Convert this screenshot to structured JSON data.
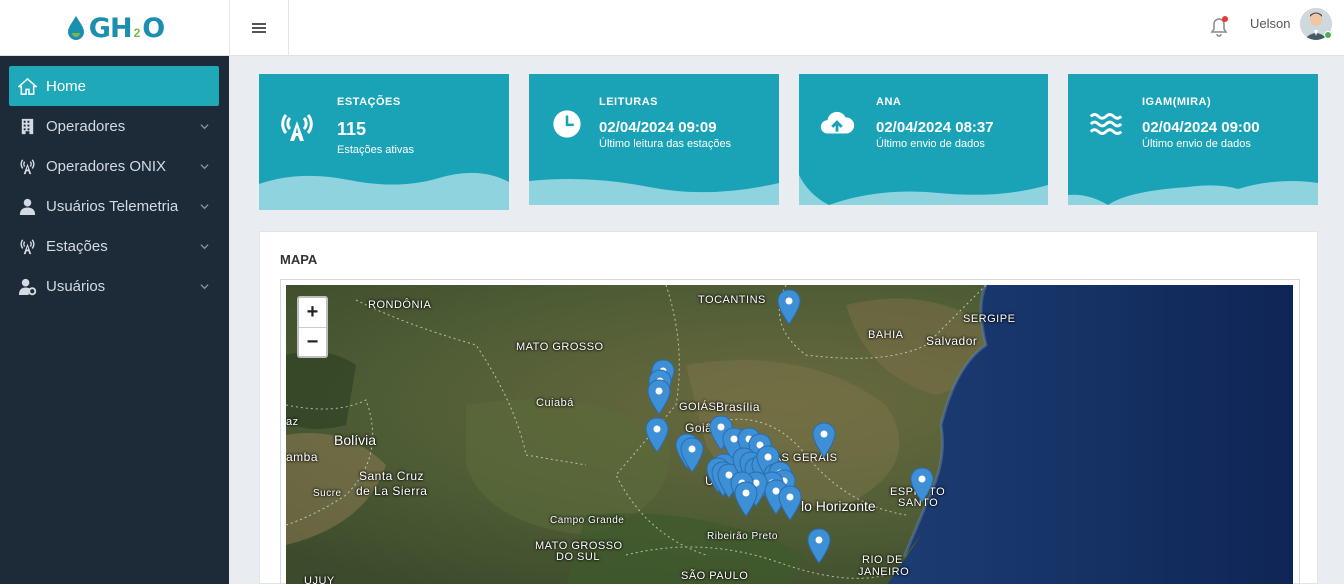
{
  "header": {
    "logo_text": "GH",
    "logo_sub": "2",
    "logo_tail": "O",
    "username": "Uelson"
  },
  "sidebar": {
    "items": [
      {
        "label": "Home",
        "icon": "home-icon"
      },
      {
        "label": "Operadores",
        "icon": "building-icon"
      },
      {
        "label": "Operadores ONIX",
        "icon": "antenna-icon"
      },
      {
        "label": "Usuários Telemetria",
        "icon": "user-icon"
      },
      {
        "label": "Estações",
        "icon": "antenna-icon"
      },
      {
        "label": "Usuários",
        "icon": "user-gear-icon"
      }
    ]
  },
  "cards": [
    {
      "title": "ESTAÇÕES",
      "value": "115",
      "desc": "Estações ativas",
      "icon": "antenna-icon"
    },
    {
      "title": "LEITURAS",
      "value": "02/04/2024 09:09",
      "desc": "Último leitura das estações",
      "icon": "clock-icon"
    },
    {
      "title": "ANA",
      "value": "02/04/2024 08:37",
      "desc": "Último envio de dados",
      "icon": "cloud-upload-icon"
    },
    {
      "title": "IGAM(MIRA)",
      "value": "02/04/2024 09:00",
      "desc": "Último envio de dados",
      "icon": "water-waves-icon"
    }
  ],
  "map": {
    "title": "MAPA",
    "zoom_in": "+",
    "zoom_out": "−",
    "labels": {
      "rondonia": "RONDÔNIA",
      "tocantins": "TOCANTINS",
      "mato_grosso": "MATO GROSSO",
      "bahia": "BAHIA",
      "sergipe": "SERGIPE",
      "salvador": "Salvador",
      "cuiaba": "Cuiabá",
      "goias": "GOIÁS",
      "brasilia": "Brasília",
      "goiania": "Goiâ",
      "bolivia": "Bolívia",
      "az": "az",
      "amba": "amba",
      "santa_cruz_1": "Santa Cruz",
      "santa_cruz_2": "de La Sierra",
      "sucre": "Sucre",
      "minas_gerais": "MINAS GERAIS",
      "espirito_1": "ESPÍRITO",
      "espirito_2": "SANTO",
      "bh": "lo Horizonte",
      "campo_grande": "Campo Grande",
      "mato_grosso_sul_1": "MATO GROSSO",
      "mato_grosso_sul_2": "DO SUL",
      "ribeirao": "Ribeirão Preto",
      "rio_1": "RIO DE",
      "rio_2": "JANEIRO",
      "sao_paulo": "SÃO PAULO",
      "ujuy": "UJUY",
      "u": "U"
    }
  },
  "colors": {
    "accent": "#1fa8b8",
    "card": "#1aa3b7",
    "sidebar": "#1d2a38",
    "pin": "#3d8fd6"
  }
}
